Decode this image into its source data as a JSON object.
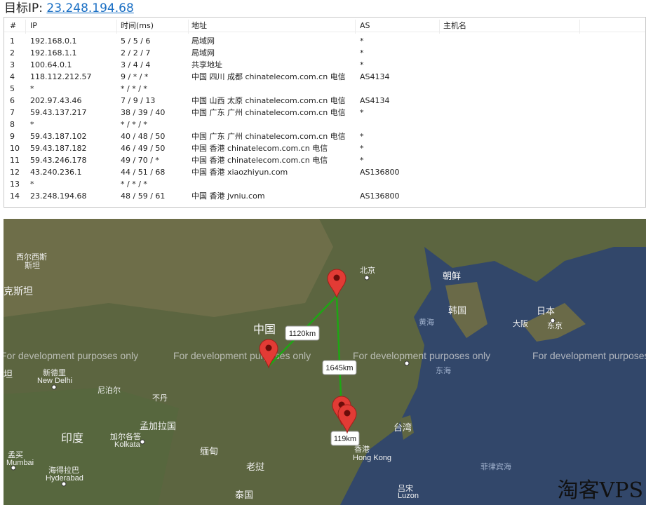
{
  "header": {
    "label": "目标IP:",
    "ip": "23.248.194.68"
  },
  "trace": {
    "columns": [
      "#",
      "IP",
      "时间(ms)",
      "地址",
      "AS",
      "主机名"
    ],
    "rows": [
      {
        "n": "1",
        "ip": "192.168.0.1",
        "time": "5 / 5 / 6",
        "addr": "局域网",
        "as": "*",
        "host": ""
      },
      {
        "n": "2",
        "ip": "192.168.1.1",
        "time": "2 / 2 / 7",
        "addr": "局域网",
        "as": "*",
        "host": ""
      },
      {
        "n": "3",
        "ip": "100.64.0.1",
        "time": "3 / 4 / 4",
        "addr": "共享地址",
        "as": "*",
        "host": ""
      },
      {
        "n": "4",
        "ip": "118.112.212.57",
        "time": "9 / * / *",
        "addr": "中国 四川 成都 chinatelecom.com.cn 电信",
        "as": "AS4134",
        "host": ""
      },
      {
        "n": "5",
        "ip": "*",
        "time": "* / * / *",
        "addr": "",
        "as": "",
        "host": ""
      },
      {
        "n": "6",
        "ip": "202.97.43.46",
        "time": "7 / 9 / 13",
        "addr": "中国 山西 太原 chinatelecom.com.cn 电信",
        "as": "AS4134",
        "host": ""
      },
      {
        "n": "7",
        "ip": "59.43.137.217",
        "time": "38 / 39 / 40",
        "addr": "中国 广东 广州 chinatelecom.com.cn 电信",
        "as": "*",
        "host": ""
      },
      {
        "n": "8",
        "ip": "*",
        "time": "* / * / *",
        "addr": "",
        "as": "",
        "host": ""
      },
      {
        "n": "9",
        "ip": "59.43.187.102",
        "time": "40 / 48 / 50",
        "addr": "中国 广东 广州 chinatelecom.com.cn 电信",
        "as": "*",
        "host": ""
      },
      {
        "n": "10",
        "ip": "59.43.187.182",
        "time": "46 / 49 / 50",
        "addr": "中国 香港 chinatelecom.com.cn 电信",
        "as": "*",
        "host": ""
      },
      {
        "n": "11",
        "ip": "59.43.246.178",
        "time": "49 / 70 / *",
        "addr": "中国 香港 chinatelecom.com.cn 电信",
        "as": "*",
        "host": ""
      },
      {
        "n": "12",
        "ip": "43.240.236.1",
        "time": "44 / 51 / 68",
        "addr": "中国 香港 xiaozhiyun.com",
        "as": "AS136800",
        "host": ""
      },
      {
        "n": "13",
        "ip": "*",
        "time": "* / * / *",
        "addr": "",
        "as": "",
        "host": ""
      },
      {
        "n": "14",
        "ip": "23.248.194.68",
        "time": "48 / 59 / 61",
        "addr": "中国 香港 jvniu.com",
        "as": "AS136800",
        "host": ""
      }
    ]
  },
  "map": {
    "watermark_text": "For development purposes only",
    "distances": [
      "1120km",
      "1645km",
      "119km"
    ],
    "places": {
      "west_china_a": "西尔西斯",
      "west_china_b": "斯坦",
      "kazakh": "克斯坦",
      "china": "中国",
      "beijing": "北京",
      "korea_n": "朝鲜",
      "korea_s": "韩国",
      "japan": "日本",
      "tokyo": "东京",
      "osaka": "大阪",
      "delhi_cn": "新德里",
      "delhi_en": "New Delhi",
      "nepal": "尼泊尔",
      "bhutan": "不丹",
      "bangladesh": "孟加拉国",
      "kolkata_cn": "加尔各答",
      "kolkata_en": "Kolkata",
      "india": "印度",
      "mumbai_cn": "孟买",
      "mumbai_en": "Mumbai",
      "hyderabad_cn": "海得拉巴",
      "hyderabad_en": "Hyderabad",
      "myanmar": "缅甸",
      "laos": "老挝",
      "thailand": "泰国",
      "hk_cn": "香港",
      "hk_en": "Hong Kong",
      "taiwan": "台湾",
      "luzon": "吕宋",
      "luzon_en": "Luzon",
      "yellow_sea": "黄海",
      "east_sea": "东海",
      "ph_sea": "菲律宾海",
      "tan": "坦"
    },
    "site_watermark": "淘客VPS",
    "colors": {
      "route": "#1ea614",
      "pin": "#e23b35"
    }
  }
}
